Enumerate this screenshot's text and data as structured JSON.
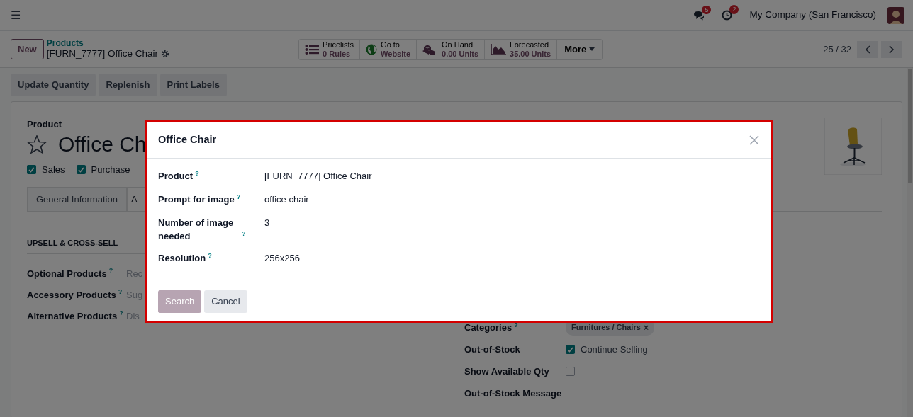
{
  "navbar": {
    "menu_icon": "☰",
    "notifications": [
      {
        "kind": "chat",
        "count": "5"
      },
      {
        "kind": "activity",
        "count": "2"
      }
    ],
    "company": "My Company (San Francisco)"
  },
  "control_panel": {
    "new_button": "New",
    "breadcrumb": "Products",
    "record_title": "[FURN_7777] Office Chair",
    "smart_buttons": [
      {
        "kind": "list",
        "line_1": "Pricelists",
        "line_2": "0 Rules"
      },
      {
        "kind": "globe",
        "line_1": "Go to",
        "line_2": "Website"
      },
      {
        "kind": "cubes",
        "line_1": "On Hand",
        "line_2": "0.00 Units"
      },
      {
        "kind": "chart",
        "line_1": "Forecasted",
        "line_2": "35.00 Units"
      }
    ],
    "more": "More",
    "pager": "25 / 32"
  },
  "actions": [
    "Update Quantity",
    "Replenish",
    "Print Labels"
  ],
  "form": {
    "label": "Product",
    "name": "Office Ch",
    "starred": false,
    "options": [
      {
        "label": "Sales",
        "checked": true
      },
      {
        "label": "Purchase",
        "checked": true
      }
    ],
    "tabs": [
      {
        "label": "General Information",
        "selected": false
      },
      {
        "label": "A",
        "selected": true
      }
    ],
    "section_title": "UPSELL & CROSS-SELL",
    "left_fields": [
      {
        "label": "Optional Products",
        "help": "?",
        "placeholder": "Rec"
      },
      {
        "label": "Accessory Products",
        "help": "?",
        "placeholder": "Sug"
      },
      {
        "label": "Alternative Products",
        "help": "?",
        "placeholder": "Dis"
      }
    ],
    "right_fields": [
      {
        "kind": "tags",
        "label": "Categories",
        "help": "?",
        "tag": "Furnitures / Chairs",
        "remove": "×"
      },
      {
        "kind": "checkbox",
        "label": "Out-of-Stock",
        "checked": true,
        "text": "Continue Selling"
      },
      {
        "kind": "checkbox",
        "label": "Show Available Qty",
        "checked": false
      },
      {
        "kind": "label",
        "label": "Out-of-Stock Message"
      }
    ]
  },
  "dialog": {
    "title": "Office Chair",
    "fields": [
      {
        "label": "Product",
        "help": "?",
        "value": "[FURN_7777] Office Chair"
      },
      {
        "label": "Prompt for image",
        "help": "?",
        "value": "office chair"
      },
      {
        "label": "Number of image needed",
        "help": "?",
        "value": "3"
      },
      {
        "label": "Resolution",
        "help": "?",
        "value": "256x256"
      }
    ],
    "buttons": [
      {
        "kind": "primary",
        "label": "Search",
        "disabled": true
      },
      {
        "kind": "secondary",
        "label": "Cancel",
        "disabled": false
      }
    ]
  }
}
